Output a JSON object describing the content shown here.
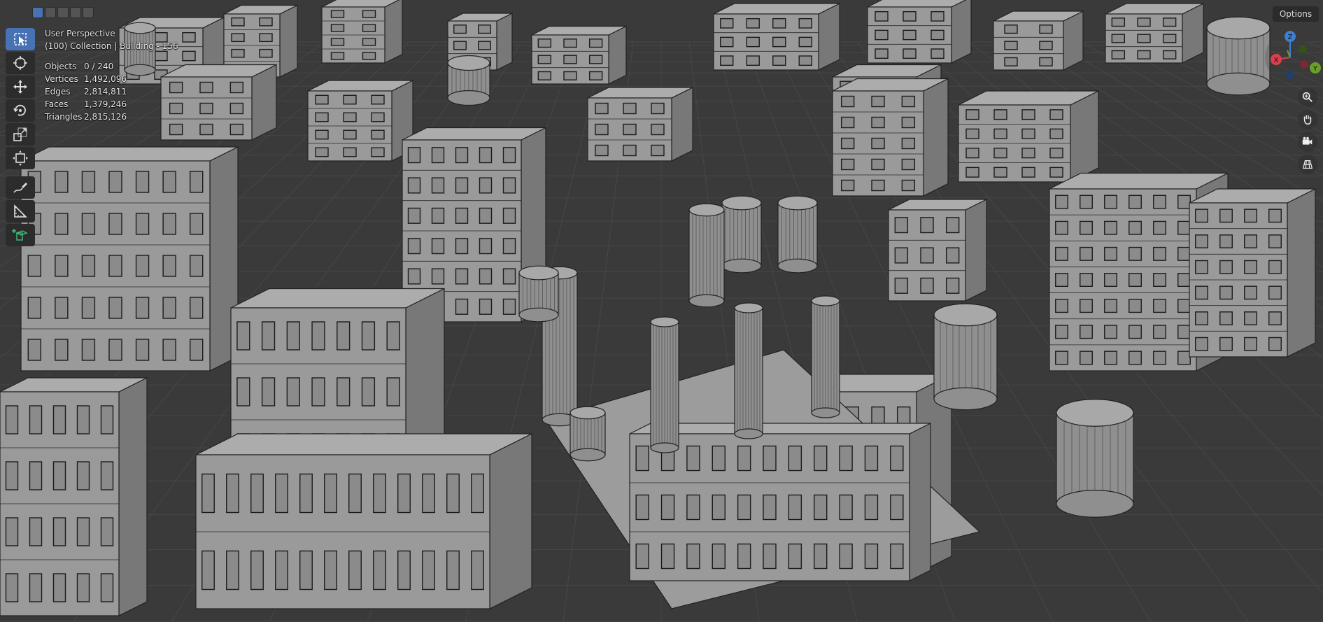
{
  "viewport": {
    "perspective_label": "User Perspective",
    "collection_label": "(100) Collection | Building - 156",
    "stats": [
      {
        "label": "Objects",
        "value": "0 / 240"
      },
      {
        "label": "Vertices",
        "value": "1,492,096"
      },
      {
        "label": "Edges",
        "value": "2,814,811"
      },
      {
        "label": "Faces",
        "value": "1,379,246"
      },
      {
        "label": "Triangles",
        "value": "2,815,126"
      }
    ]
  },
  "header": {
    "options_label": "Options",
    "select_modes": [
      "set-selection-icon",
      "extend-selection-icon",
      "subtract-selection-icon",
      "invert-selection-icon",
      "intersect-selection-icon"
    ]
  },
  "toolbar": {
    "tools": [
      "select-box-icon",
      "cursor-icon",
      "move-icon",
      "rotate-icon",
      "scale-icon",
      "transform-icon",
      "annotate-icon",
      "measure-icon",
      "add-cube-icon"
    ],
    "active_tool": "select-box-icon"
  },
  "gizmo": {
    "axes": [
      "Z",
      "Y",
      "X"
    ],
    "colors": {
      "x": "#d9404f",
      "y": "#6aa02a",
      "z": "#3e7fd4"
    }
  },
  "navigation": {
    "icons": [
      "zoom-icon",
      "pan-hand-icon",
      "camera-view-icon",
      "ortho-grid-icon"
    ]
  },
  "colors": {
    "background": "#3a3a3a",
    "grid": "#474747",
    "building": "#9a9a9a",
    "accent": "#4772b3",
    "panel": "#2c2c2c"
  }
}
